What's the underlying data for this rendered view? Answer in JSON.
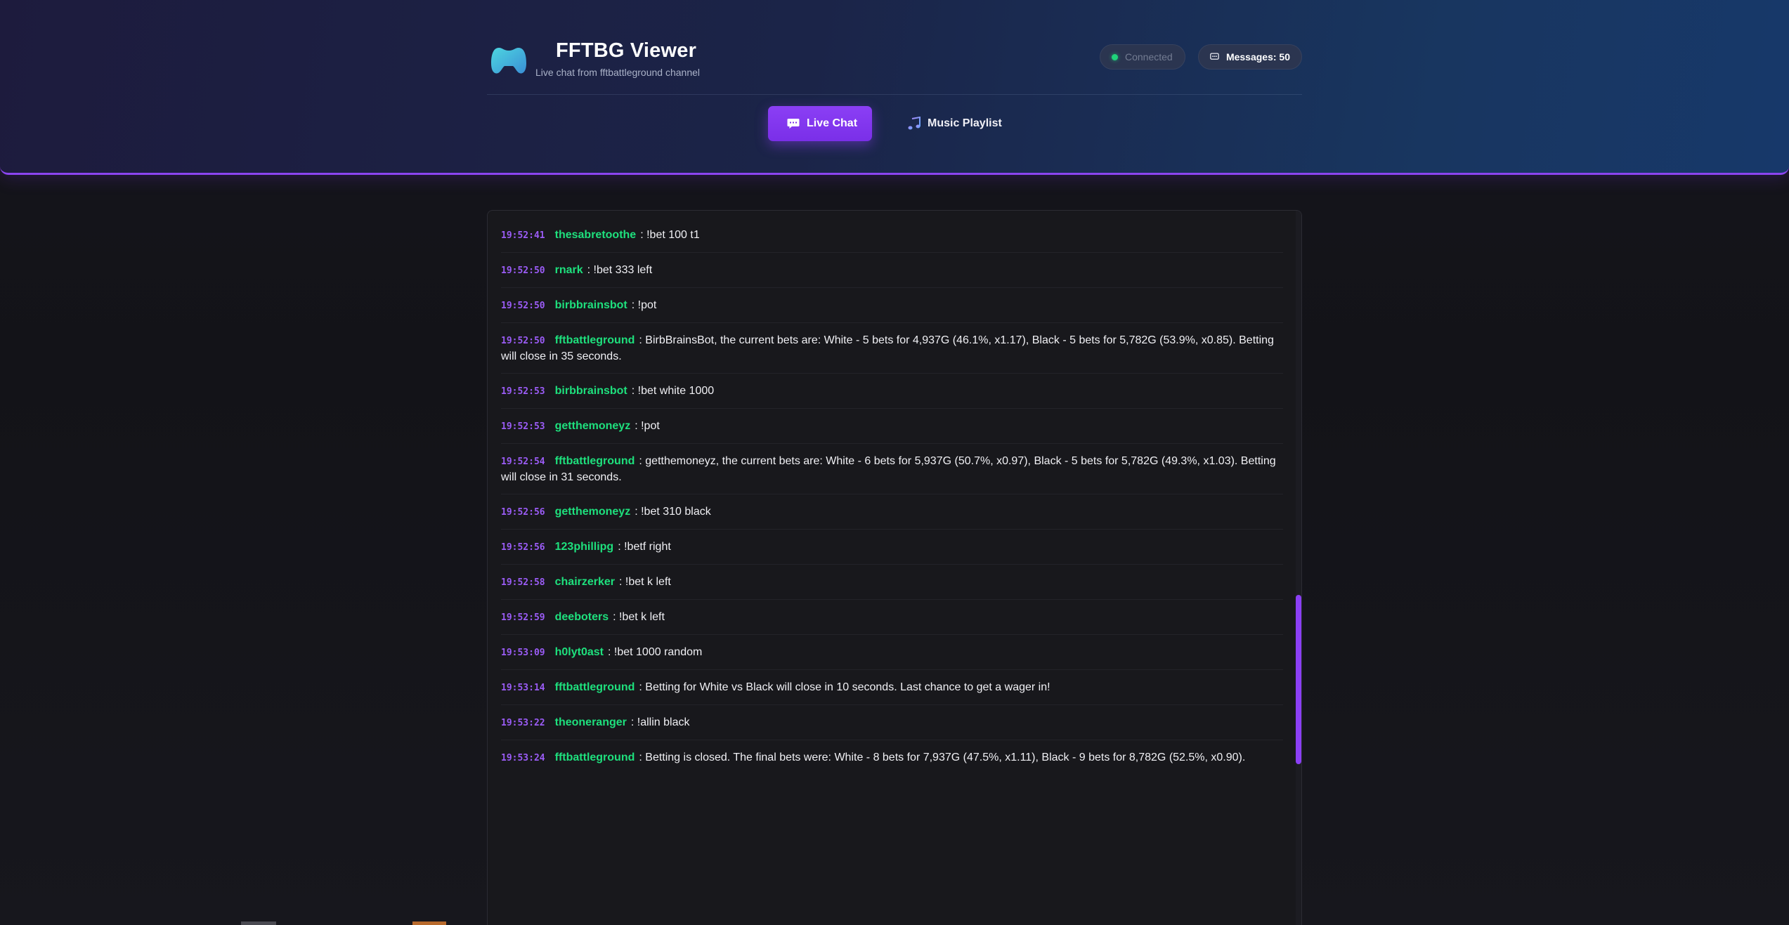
{
  "header": {
    "title": "FFTBG Viewer",
    "subtitle": "Live chat from fftbattleground channel",
    "logo_icon": "gamepad-icon",
    "status_label": "Connected",
    "status_color": "#1fd47a",
    "messages_label": "Messages: 50"
  },
  "tabs": [
    {
      "label": "Live Chat",
      "icon": "chat-icon",
      "active": true
    },
    {
      "label": "Music Playlist",
      "icon": "music-note-icon",
      "active": false
    }
  ],
  "colors": {
    "accent": "#8b3ff5",
    "timestamp": "#9b5cf6",
    "username": "#1ee07d"
  },
  "messages": [
    {
      "time": "19:52:41",
      "user": "thesabretoothe",
      "text": ": !bet 100 t1"
    },
    {
      "time": "19:52:50",
      "user": "rnark",
      "text": ": !bet 333 left"
    },
    {
      "time": "19:52:50",
      "user": "birbbrainsbot",
      "text": ": !pot"
    },
    {
      "time": "19:52:50",
      "user": "fftbattleground",
      "text": ": BirbBrainsBot, the current bets are: White - 5 bets for 4,937G (46.1%, x1.17), Black - 5 bets for 5,782G (53.9%, x0.85). Betting will close in 35 seconds."
    },
    {
      "time": "19:52:53",
      "user": "birbbrainsbot",
      "text": ": !bet white 1000"
    },
    {
      "time": "19:52:53",
      "user": "getthemoneyz",
      "text": ": !pot"
    },
    {
      "time": "19:52:54",
      "user": "fftbattleground",
      "text": ": getthemoneyz, the current bets are: White - 6 bets for 5,937G (50.7%, x0.97), Black - 5 bets for 5,782G (49.3%, x1.03). Betting will close in 31 seconds."
    },
    {
      "time": "19:52:56",
      "user": "getthemoneyz",
      "text": ": !bet 310 black"
    },
    {
      "time": "19:52:56",
      "user": "123phillipg",
      "text": ": !betf right"
    },
    {
      "time": "19:52:58",
      "user": "chairzerker",
      "text": ": !bet k left"
    },
    {
      "time": "19:52:59",
      "user": "deeboters",
      "text": ": !bet k left"
    },
    {
      "time": "19:53:09",
      "user": "h0lyt0ast",
      "text": ": !bet 1000 random"
    },
    {
      "time": "19:53:14",
      "user": "fftbattleground",
      "text": ": Betting for White vs Black will close in 10 seconds. Last chance to get a wager in!"
    },
    {
      "time": "19:53:22",
      "user": "theoneranger",
      "text": ": !allin black"
    },
    {
      "time": "19:53:24",
      "user": "fftbattleground",
      "text": ": Betting is closed. The final bets were: White - 8 bets for 7,937G (47.5%, x1.11), Black - 9 bets for 8,782G (52.5%, x0.90)."
    }
  ]
}
